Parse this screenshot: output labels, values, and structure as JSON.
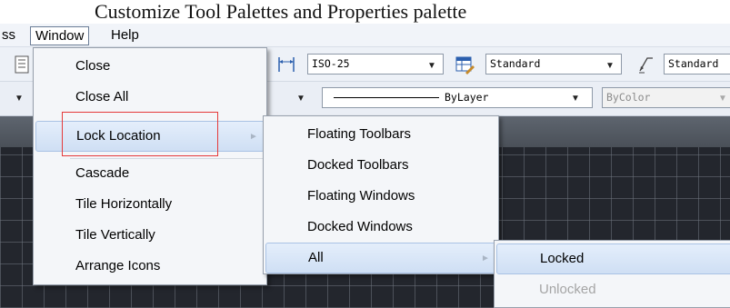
{
  "caption": "Customize Tool Palettes and Properties palette",
  "menubar": {
    "items": [
      "ss",
      "Window",
      "Help"
    ]
  },
  "toolbar1": {
    "dimstyle": "ISO-25",
    "tablestyle": "Standard",
    "mleaderstyle": "Standard"
  },
  "toolbar2": {
    "linetype": "ByLayer",
    "plotstyle": "ByColor"
  },
  "window_menu": {
    "items": [
      "Close",
      "Close All",
      "Lock Location",
      "Cascade",
      "Tile Horizontally",
      "Tile Vertically",
      "Arrange Icons"
    ]
  },
  "lock_location_menu": {
    "items": [
      "Floating Toolbars",
      "Docked Toolbars",
      "Floating Windows",
      "Docked Windows",
      "All"
    ]
  },
  "all_menu": {
    "items": [
      "Locked",
      "Unlocked"
    ]
  },
  "colors": {
    "highlight_border": "#e53a3a",
    "drawing_bg": "#23262d"
  }
}
